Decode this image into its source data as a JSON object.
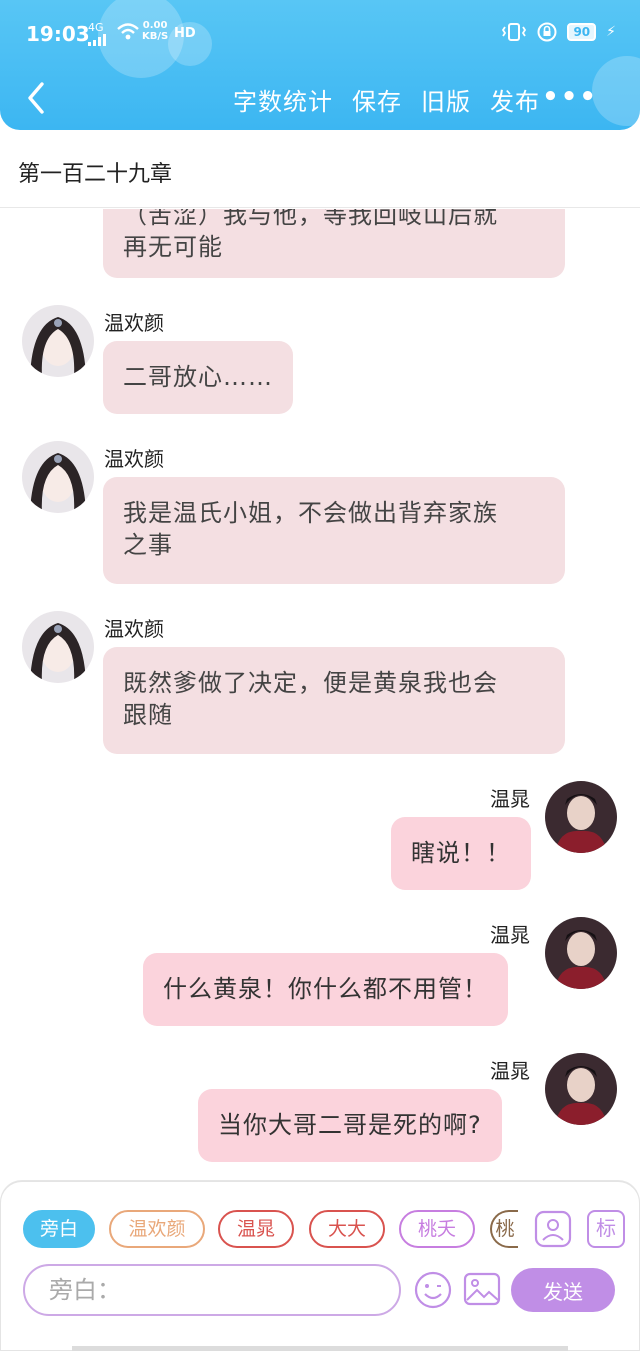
{
  "status": {
    "time": "19:03",
    "net_type": "4G",
    "speed_value": "0.00",
    "speed_unit": "KB/S",
    "hd": "HD",
    "battery": "90"
  },
  "nav": {
    "word_count": "字数统计",
    "save": "保存",
    "old_version": "旧版",
    "publish": "发布",
    "more": "•••"
  },
  "chapter_title": "第一百二十九章",
  "messages": [
    {
      "side": "left",
      "sender": "",
      "text_lines": [
        "（苦涩）我与他，等我回岐山后就",
        "再无可能"
      ]
    },
    {
      "side": "left",
      "sender": "温欢颜",
      "text_lines": [
        "二哥放心……"
      ]
    },
    {
      "side": "left",
      "sender": "温欢颜",
      "text_lines": [
        "我是温氏小姐，不会做出背弃家族",
        "之事"
      ]
    },
    {
      "side": "left",
      "sender": "温欢颜",
      "text_lines": [
        "既然爹做了决定，便是黄泉我也会",
        "跟随"
      ]
    },
    {
      "side": "right",
      "sender": "温晁",
      "text_lines": [
        "瞎说！！"
      ]
    },
    {
      "side": "right",
      "sender": "温晁",
      "text_lines": [
        "什么黄泉！你什么都不用管！"
      ]
    },
    {
      "side": "right",
      "sender": "温晁",
      "text_lines": [
        "当你大哥二哥是死的啊?"
      ]
    }
  ],
  "roles": [
    {
      "label": "旁白",
      "color": "#4cc0ee",
      "active": true
    },
    {
      "label": "温欢颜",
      "color": "#e9a87a",
      "active": false
    },
    {
      "label": "温晁",
      "color": "#d9534f",
      "active": false
    },
    {
      "label": "大大",
      "color": "#d9534f",
      "active": false
    },
    {
      "label": "桃夭",
      "color": "#c77ee0",
      "active": false
    },
    {
      "label": "桃",
      "color": "#8a6a4a",
      "active": false
    }
  ],
  "tag_button": "标",
  "input": {
    "placeholder": "旁白："
  },
  "send_label": "发送",
  "icons": [
    "back-icon",
    "wifi-icon",
    "signal-icon",
    "vibrate-icon",
    "lock-icon",
    "role-manage-icon",
    "emoji-icon",
    "image-icon"
  ],
  "colors": {
    "header": "#3cb6f2",
    "bubble_left": "#f4dfe2",
    "bubble_right": "#fbd3dc",
    "send": "#c08ee6"
  }
}
